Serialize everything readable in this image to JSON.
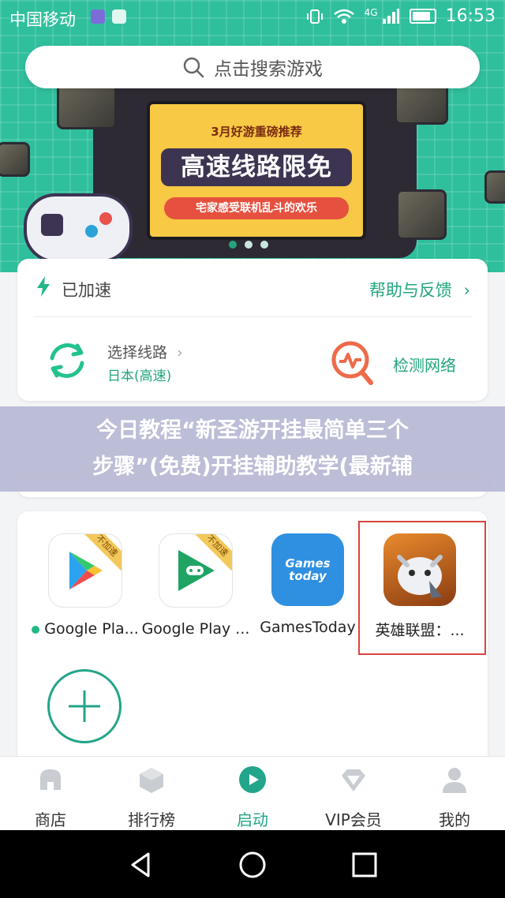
{
  "status_bar": {
    "carrier": "中国移动",
    "network": "4G",
    "time": "16:53"
  },
  "search": {
    "placeholder": "点击搜索游戏"
  },
  "banner": {
    "subtitle_top": "3月好游重磅推荐",
    "headline": "高速线路限免",
    "subtitle_bottom": "宅家感受联机乱斗的欢乐",
    "page_count": 3,
    "active_page": 1
  },
  "accelerator": {
    "status": "已加速",
    "help_link": "帮助与反馈",
    "route_label": "选择线路",
    "route_value": "日本(高速)",
    "detect_label": "检测网络"
  },
  "overlay": {
    "line1": "今日教程“新圣游开挂最简单三个",
    "line2": "步骤”(免费)开挂辅助教学(最新辅"
  },
  "games": [
    {
      "name": "Google Pla...",
      "badge": "不加速",
      "running": true
    },
    {
      "name": "Google Play ...",
      "badge": "不加速",
      "running": false
    },
    {
      "name": "GamesToday",
      "badge": "",
      "running": false
    },
    {
      "name": "英雄联盟：...",
      "badge": "",
      "running": false,
      "selected": true
    }
  ],
  "gamestoday_icon_text": "Games today",
  "bottom_nav": [
    {
      "label": "商店",
      "icon": "store-icon"
    },
    {
      "label": "排行榜",
      "icon": "ranking-icon"
    },
    {
      "label": "启动",
      "icon": "launch-icon",
      "active": true
    },
    {
      "label": "VIP会员",
      "icon": "vip-icon"
    },
    {
      "label": "我的",
      "icon": "profile-icon"
    }
  ],
  "colors": {
    "accent": "#22a58a",
    "hero_bg": "#2fbf9c",
    "selection_border": "#d8453f"
  }
}
